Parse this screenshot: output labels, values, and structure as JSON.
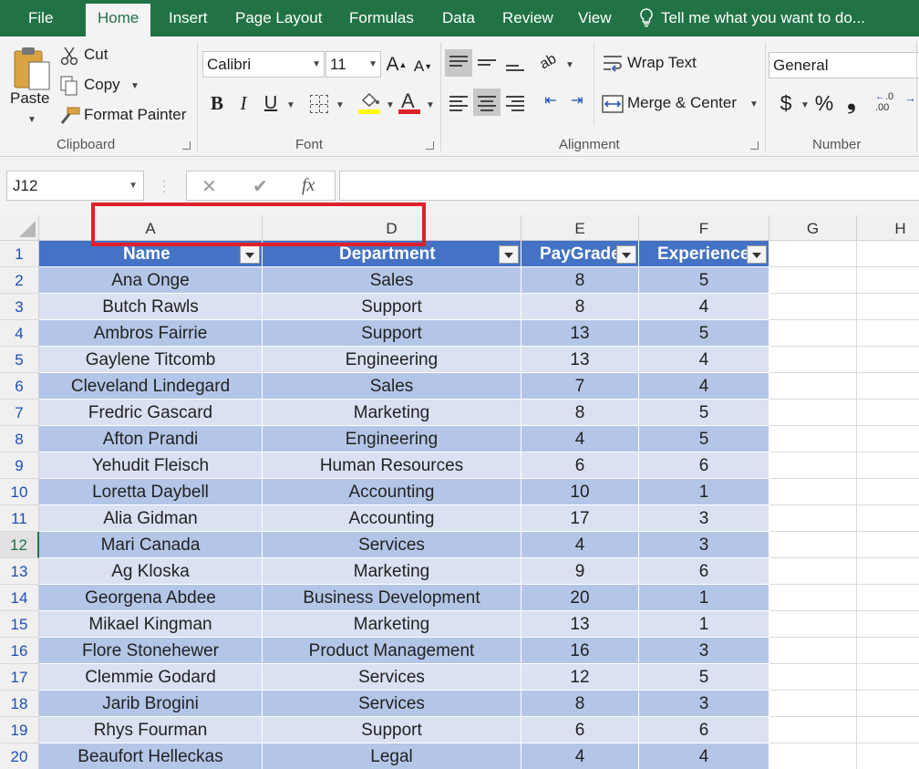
{
  "menu": {
    "tabs": [
      "File",
      "Home",
      "Insert",
      "Page Layout",
      "Formulas",
      "Data",
      "Review",
      "View"
    ],
    "active_tab": "Home",
    "tell_me": "Tell me what you want to do..."
  },
  "ribbon": {
    "clipboard": {
      "paste": "Paste",
      "cut": "Cut",
      "copy": "Copy",
      "format_painter": "Format Painter",
      "label": "Clipboard"
    },
    "font": {
      "family": "Calibri",
      "size": "11",
      "bold": "B",
      "italic": "I",
      "underline": "U",
      "label": "Font"
    },
    "alignment": {
      "wrap_text": "Wrap Text",
      "merge_center": "Merge & Center",
      "label": "Alignment"
    },
    "number": {
      "format": "General",
      "currency": "$",
      "percent": "%",
      "comma": "❟",
      "label": "Number"
    }
  },
  "formula_bar": {
    "name_box": "J12",
    "fx": "fx",
    "value": ""
  },
  "grid": {
    "columns": [
      "A",
      "D",
      "E",
      "F",
      "G",
      "H"
    ],
    "header_row": {
      "row": "1",
      "cells": [
        "Name",
        "Department",
        "PayGrade",
        "Experience"
      ]
    },
    "selected_row": "12",
    "rows": [
      {
        "row": "2",
        "cells": [
          "Ana Onge",
          "Sales",
          "8",
          "5"
        ]
      },
      {
        "row": "3",
        "cells": [
          "Butch Rawls",
          "Support",
          "8",
          "4"
        ]
      },
      {
        "row": "4",
        "cells": [
          "Ambros Fairrie",
          "Support",
          "13",
          "5"
        ]
      },
      {
        "row": "5",
        "cells": [
          "Gaylene Titcomb",
          "Engineering",
          "13",
          "4"
        ]
      },
      {
        "row": "6",
        "cells": [
          "Cleveland Lindegard",
          "Sales",
          "7",
          "4"
        ]
      },
      {
        "row": "7",
        "cells": [
          "Fredric Gascard",
          "Marketing",
          "8",
          "5"
        ]
      },
      {
        "row": "8",
        "cells": [
          "Afton Prandi",
          "Engineering",
          "4",
          "5"
        ]
      },
      {
        "row": "9",
        "cells": [
          "Yehudit Fleisch",
          "Human Resources",
          "6",
          "6"
        ]
      },
      {
        "row": "10",
        "cells": [
          "Loretta Daybell",
          "Accounting",
          "10",
          "1"
        ]
      },
      {
        "row": "11",
        "cells": [
          "Alia Gidman",
          "Accounting",
          "17",
          "3"
        ]
      },
      {
        "row": "12",
        "cells": [
          "Mari Canada",
          "Services",
          "4",
          "3"
        ]
      },
      {
        "row": "13",
        "cells": [
          "Ag Kloska",
          "Marketing",
          "9",
          "6"
        ]
      },
      {
        "row": "14",
        "cells": [
          "Georgena Abdee",
          "Business Development",
          "20",
          "1"
        ]
      },
      {
        "row": "15",
        "cells": [
          "Mikael Kingman",
          "Marketing",
          "13",
          "1"
        ]
      },
      {
        "row": "16",
        "cells": [
          "Flore Stonehewer",
          "Product Management",
          "16",
          "3"
        ]
      },
      {
        "row": "17",
        "cells": [
          "Clemmie Godard",
          "Services",
          "12",
          "5"
        ]
      },
      {
        "row": "18",
        "cells": [
          "Jarib Brogini",
          "Services",
          "8",
          "3"
        ]
      },
      {
        "row": "19",
        "cells": [
          "Rhys Fourman",
          "Support",
          "6",
          "6"
        ]
      },
      {
        "row": "20",
        "cells": [
          "Beaufort Helleckas",
          "Legal",
          "4",
          "4"
        ]
      }
    ]
  },
  "colors": {
    "excel_green": "#217346",
    "table_header": "#4472c4",
    "band_dark": "#b4c6e7",
    "band_light": "#d9e1f2",
    "highlight": "#e0202a"
  }
}
